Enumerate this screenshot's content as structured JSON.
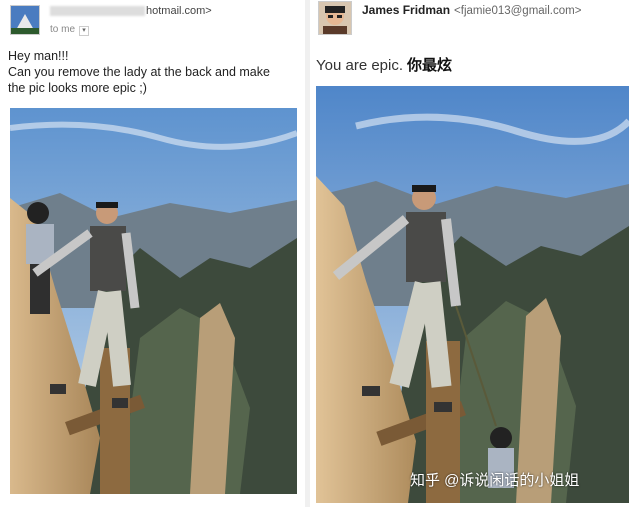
{
  "left_panel": {
    "sender": {
      "email_suffix": "hotmail.com>",
      "to": "to me"
    },
    "message": [
      "Hey man!!!",
      "Can you remove the lady at the back and make",
      "the pic looks more epic ;)"
    ]
  },
  "right_panel": {
    "sender": {
      "name": "James Fridman",
      "email": "<fjamie013@gmail.com>"
    },
    "message": "You are epic.",
    "message_cjk": "你最炫"
  },
  "watermark": "知乎 @诉说闲话的小姐姐"
}
